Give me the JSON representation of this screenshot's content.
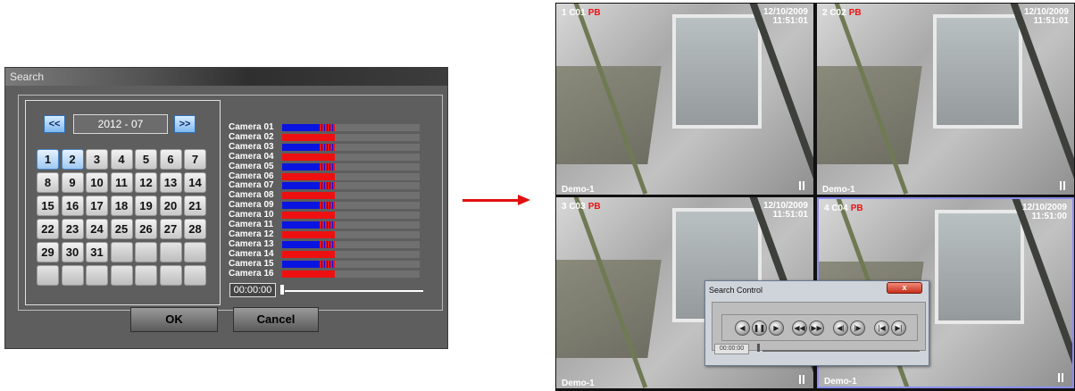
{
  "search_dialog": {
    "title": "Search",
    "month": "2012 - 07",
    "prev_label": "<<",
    "next_label": ">>",
    "days": [
      "1",
      "2",
      "3",
      "4",
      "5",
      "6",
      "7",
      "8",
      "9",
      "10",
      "11",
      "12",
      "13",
      "14",
      "15",
      "16",
      "17",
      "18",
      "19",
      "20",
      "21",
      "22",
      "23",
      "24",
      "25",
      "26",
      "27",
      "28",
      "29",
      "30",
      "31",
      "",
      "",
      "",
      "",
      "",
      "",
      "",
      "",
      "",
      "",
      ""
    ],
    "selected_days": [
      "1",
      "2"
    ],
    "cameras": [
      {
        "label": "Camera 01",
        "bar": "blue"
      },
      {
        "label": "Camera 02",
        "bar": "red"
      },
      {
        "label": "Camera 03",
        "bar": "blue"
      },
      {
        "label": "Camera 04",
        "bar": "red"
      },
      {
        "label": "Camera 05",
        "bar": "blue"
      },
      {
        "label": "Camera 06",
        "bar": "red"
      },
      {
        "label": "Camera 07",
        "bar": "blue"
      },
      {
        "label": "Camera 08",
        "bar": "red"
      },
      {
        "label": "Camera 09",
        "bar": "blue"
      },
      {
        "label": "Camera 10",
        "bar": "red"
      },
      {
        "label": "Camera 11",
        "bar": "blue"
      },
      {
        "label": "Camera 12",
        "bar": "red"
      },
      {
        "label": "Camera 13",
        "bar": "blue"
      },
      {
        "label": "Camera 14",
        "bar": "red"
      },
      {
        "label": "Camera 15",
        "bar": "blue"
      },
      {
        "label": "Camera 16",
        "bar": "red"
      }
    ],
    "time": "00:00:00",
    "ok_label": "OK",
    "cancel_label": "Cancel",
    "colors": {
      "blue": "#0a14e0",
      "red": "#ee1010"
    }
  },
  "dvr": {
    "panes": [
      {
        "id": "1 C01",
        "mode": "PB",
        "date": "12/10/2009",
        "time": "11:51:01",
        "site": "Demo-1",
        "selected": false
      },
      {
        "id": "2 C02",
        "mode": "PB",
        "date": "12/10/2009",
        "time": "11:51:01",
        "site": "Demo-1",
        "selected": false
      },
      {
        "id": "3 C03",
        "mode": "PB",
        "date": "12/10/2009",
        "time": "11:51:01",
        "site": "Demo-1",
        "selected": false
      },
      {
        "id": "4 C04",
        "mode": "PB",
        "date": "12/10/2009",
        "time": "11:51:00",
        "site": "Demo-1",
        "selected": true
      }
    ]
  },
  "search_control": {
    "title": "Search Control",
    "close_label": "x",
    "controls": [
      {
        "name": "reverse-play-icon",
        "glyph": "◀"
      },
      {
        "name": "pause-icon",
        "glyph": "❚❚"
      },
      {
        "name": "play-icon",
        "glyph": "▶"
      },
      {
        "name": "rewind-icon",
        "glyph": "◀◀"
      },
      {
        "name": "fast-forward-icon",
        "glyph": "▶▶"
      },
      {
        "name": "step-back-icon",
        "glyph": "◀|"
      },
      {
        "name": "step-forward-icon",
        "glyph": "|▶"
      },
      {
        "name": "skip-start-icon",
        "glyph": "|◀"
      },
      {
        "name": "skip-end-icon",
        "glyph": "▶|"
      }
    ],
    "time": "00:00:00"
  }
}
